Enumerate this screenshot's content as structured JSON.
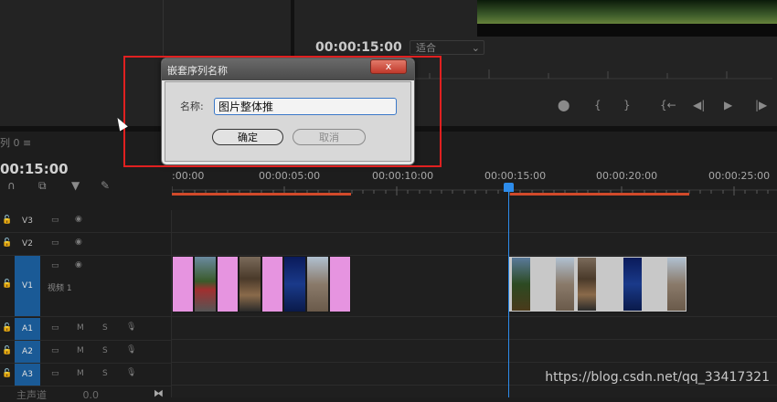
{
  "source_panel": {
    "label": ""
  },
  "program": {
    "timecode": "00:00:15:00",
    "fit_option": "适合",
    "controls": [
      "mark-in",
      "mark-out",
      "go-to-in",
      "step-back",
      "play",
      "step-forward"
    ]
  },
  "timeline": {
    "tab_label": "列 0 ≡",
    "timecode": "00:15:00",
    "ruler_labels": [
      ":00:00",
      "00:00:05:00",
      "00:00:10:00",
      "00:00:15:00",
      "00:00:20:00",
      "00:00:25:00"
    ],
    "tracks": [
      {
        "name": "V3",
        "active": false
      },
      {
        "name": "V2",
        "active": false
      },
      {
        "name": "V1",
        "active": true,
        "clip_label": "视频 1"
      },
      {
        "name": "A1",
        "active": true
      },
      {
        "name": "A2",
        "active": true
      },
      {
        "name": "A3",
        "active": true
      }
    ],
    "audio_toggles": [
      "M",
      "S"
    ],
    "master_label": "主声道",
    "master_value": "0.0"
  },
  "dialog": {
    "title": "嵌套序列名称",
    "close_label": "x",
    "name_label": "名称:",
    "name_value": "图片整体推",
    "ok_label": "确定",
    "cancel_label": "取消"
  },
  "watermark": "https://blog.csdn.net/qq_33417321",
  "colors": {
    "accent": "#2d8ceb",
    "work_area": "#d14a2a",
    "highlight": "#e02020",
    "pink_clip": "#e694e0",
    "track_active": "#1a5a96"
  }
}
